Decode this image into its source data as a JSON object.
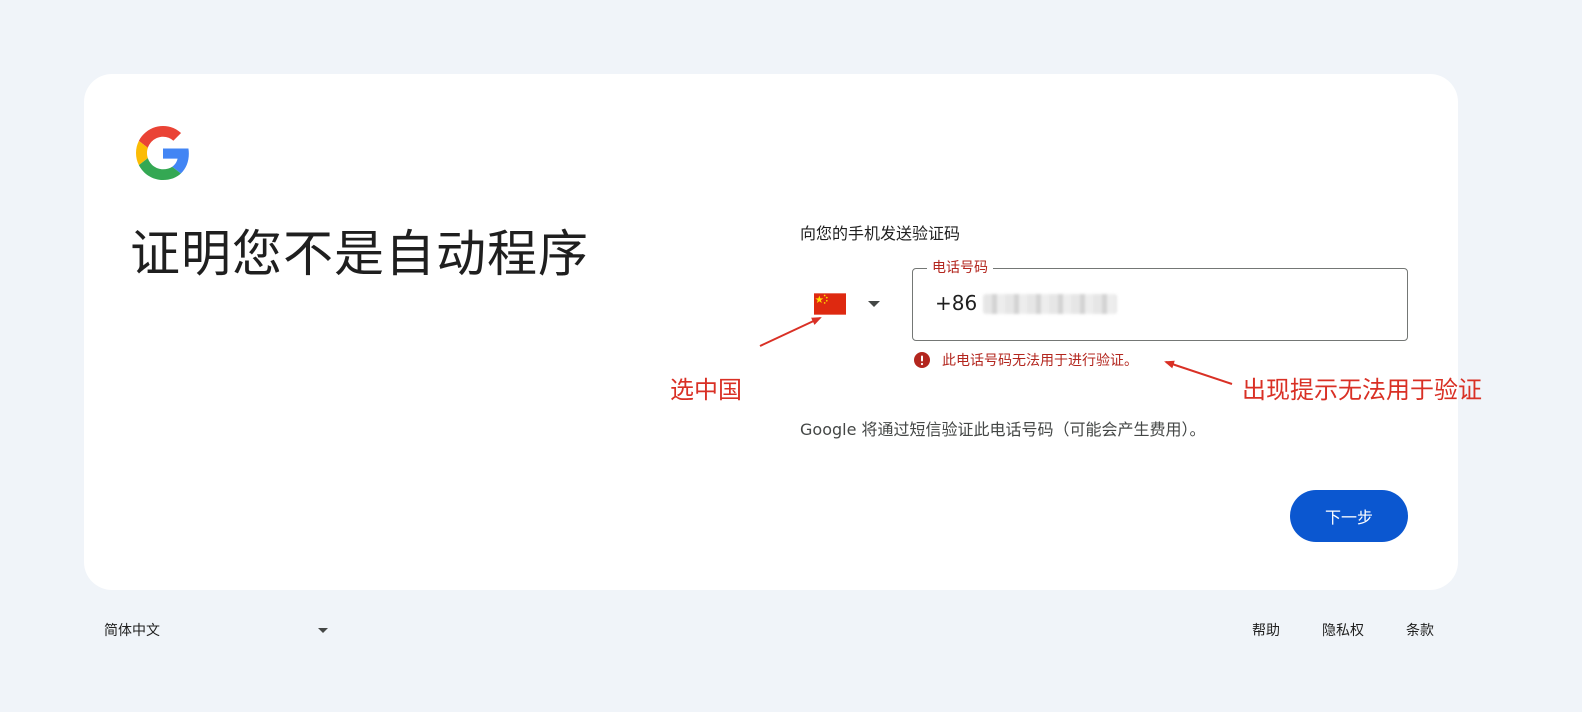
{
  "brand": {
    "logo_icon": "google-g-logo-icon"
  },
  "page_title": "证明您不是自动程序",
  "form": {
    "section_label": "向您的手机发送验证码",
    "country": {
      "flag_icon": "china-flag-icon"
    },
    "phone_field": {
      "label": "电话号码",
      "prefix": "+86"
    },
    "error_text": "此电话号码无法用于进行验证。",
    "info_text": "Google 将通过短信验证此电话号码（可能会产生费用）。",
    "next_button": "下一步"
  },
  "annotations": {
    "left": "选中国",
    "right": "出现提示无法用于验证"
  },
  "footer": {
    "language": "简体中文",
    "links": [
      "帮助",
      "隐私权",
      "条款"
    ]
  },
  "colors": {
    "accent": "#0b57d0",
    "error": "#b3261e",
    "annotation": "#d93025",
    "background": "#f0f4f9"
  }
}
